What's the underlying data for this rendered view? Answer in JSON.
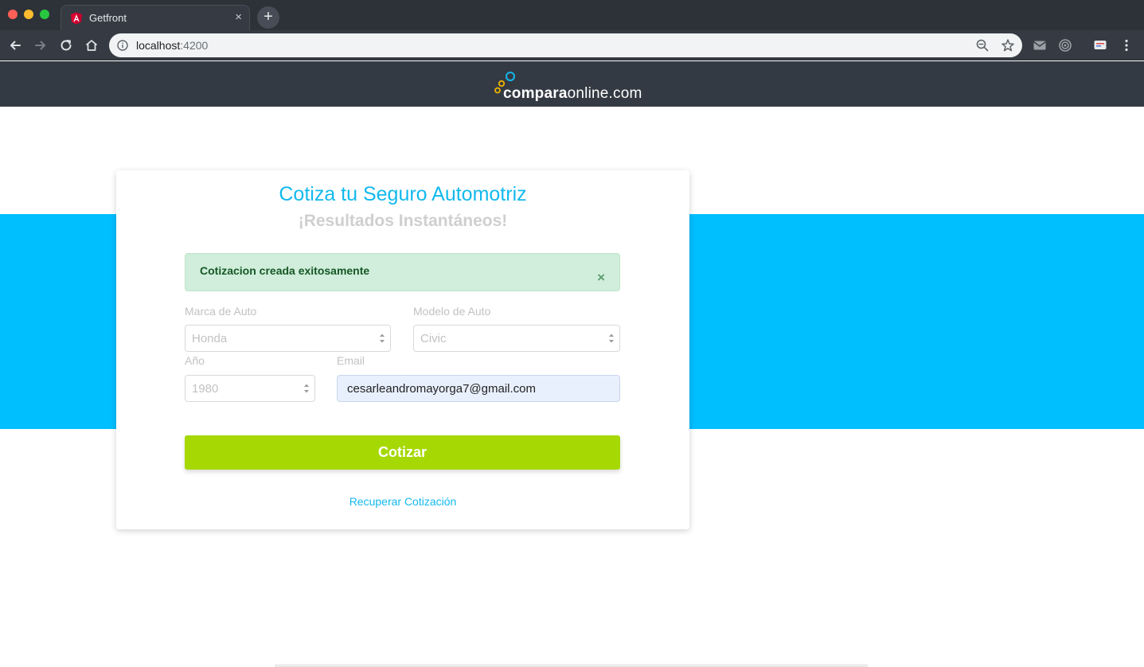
{
  "browser": {
    "tab_title": "Getfront",
    "tab_close": "×",
    "new_tab": "+",
    "url_host": "localhost",
    "url_port": ":4200"
  },
  "site": {
    "logo_bold": "compara",
    "logo_light": "online.com"
  },
  "form": {
    "title": "Cotiza tu Seguro Automotriz",
    "subtitle": "¡Resultados Instantáneos!",
    "alert_message": "Cotizacion creada exitosamente",
    "alert_close": "×",
    "brand_label": "Marca de Auto",
    "brand_value": "Honda",
    "model_label": "Modelo de Auto",
    "model_value": "Civic",
    "year_label": "Año",
    "year_value": "1980",
    "email_label": "Email",
    "email_value": "cesarleandromayorga7@gmail.com",
    "submit_label": "Cotizar",
    "recover_link": "Recuperar Cotización"
  },
  "colors": {
    "accent_blue": "#00bfff",
    "title_blue": "#13b9ed",
    "submit_green": "#a6d804",
    "alert_bg": "#d0eedb",
    "header_bg": "#343a43"
  }
}
